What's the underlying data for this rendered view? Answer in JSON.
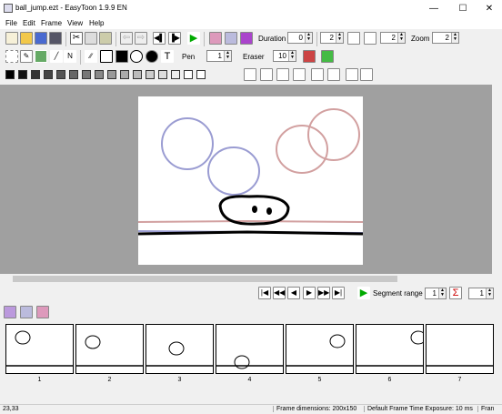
{
  "window": {
    "title": "ball_jump.ezt - EasyToon 1.9.9 EN",
    "minimize": "—",
    "maximize": "☐",
    "close": "✕"
  },
  "menu": [
    "File",
    "Edit",
    "Frame",
    "View",
    "Help"
  ],
  "toolbar1": {
    "duration_label": "Duration",
    "duration_value": "0",
    "field2": "2",
    "field3": "2",
    "zoom_label": "Zoom",
    "zoom_value": "2"
  },
  "toolbar2": {
    "pen_label": "Pen",
    "pen_value": "1",
    "eraser_label": "Eraser",
    "eraser_value": "10"
  },
  "playbar": {
    "segment_label": "Segment range",
    "seg_start": "1",
    "seg_end": "1"
  },
  "frames": [
    {
      "num": "1"
    },
    {
      "num": "2"
    },
    {
      "num": "3"
    },
    {
      "num": "4"
    },
    {
      "num": "5"
    },
    {
      "num": "6"
    },
    {
      "num": "7"
    }
  ],
  "status": {
    "coords": "23,33",
    "dims": "Frame dimensions: 200x150",
    "exposure": "Default Frame Time Exposure: 10 ms",
    "fr": "Fran"
  },
  "icons": [
    "new-icon",
    "open-icon",
    "save-icon",
    "cut-icon",
    "copy-icon",
    "paste-icon",
    "undo-icon",
    "redo-icon",
    "play-icon",
    "select-icon",
    "pencil-icon",
    "fill-icon",
    "line-icon",
    "rectangle-icon",
    "ellipse-icon",
    "text-icon"
  ]
}
